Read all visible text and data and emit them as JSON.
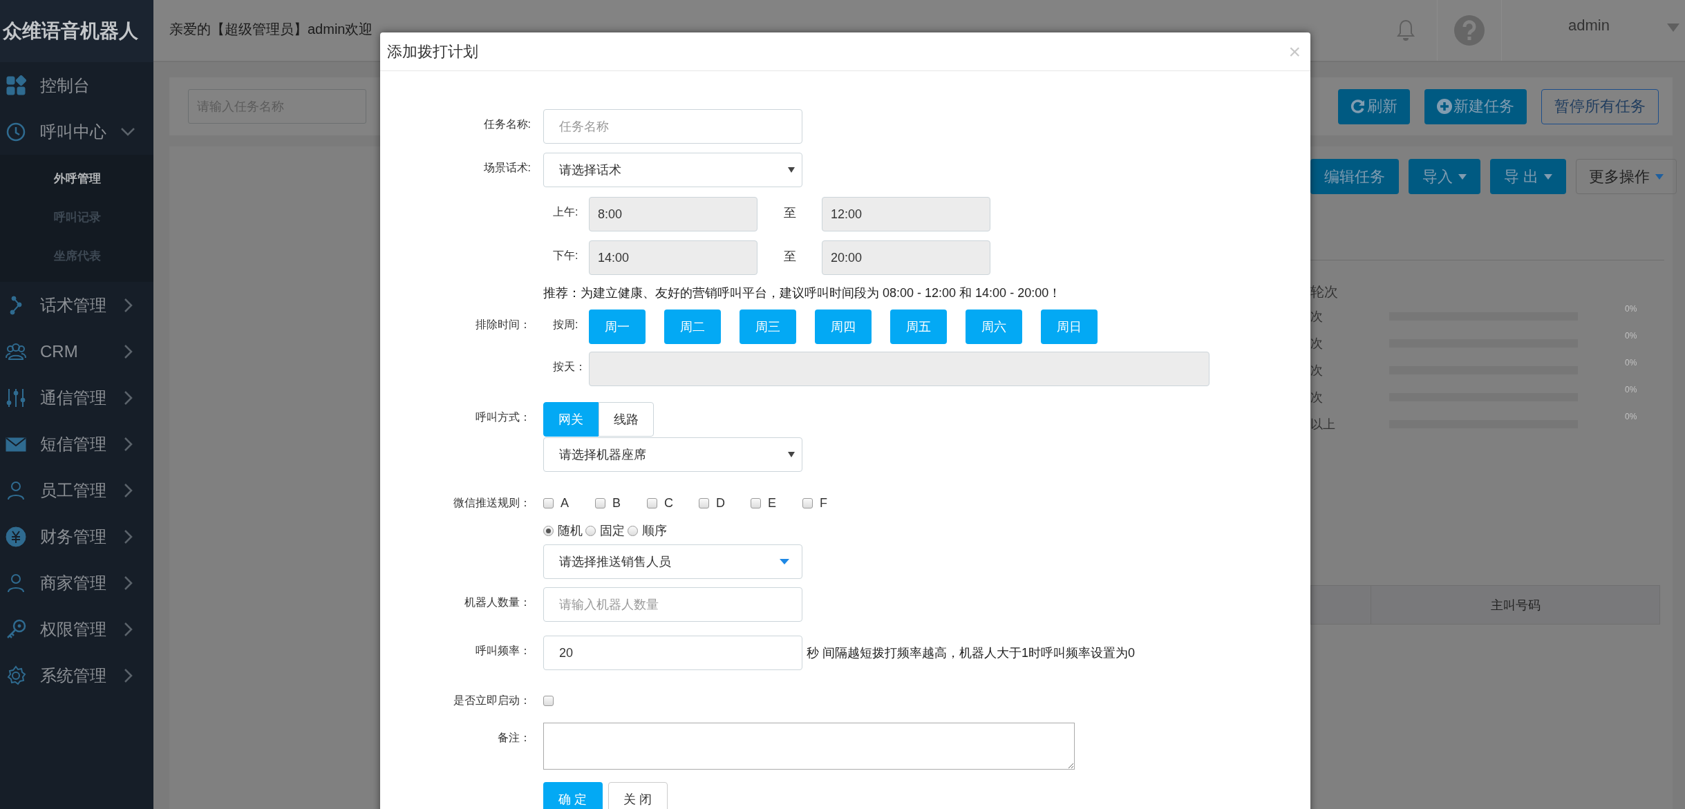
{
  "sidebar": {
    "brand": "众维语音机器人",
    "items": [
      {
        "label": "控制台",
        "kind": "link"
      },
      {
        "label": "呼叫中心",
        "kind": "group",
        "expanded": true,
        "children": [
          {
            "label": "外呼管理",
            "selected": true
          },
          {
            "label": "呼叫记录",
            "selected": false
          },
          {
            "label": "坐席代表",
            "selected": false
          }
        ]
      },
      {
        "label": "话术管理",
        "kind": "group",
        "expanded": false
      },
      {
        "label": "CRM",
        "kind": "group",
        "expanded": false
      },
      {
        "label": "通信管理",
        "kind": "group",
        "expanded": false
      },
      {
        "label": "短信管理",
        "kind": "group",
        "expanded": false
      },
      {
        "label": "员工管理",
        "kind": "group",
        "expanded": false
      },
      {
        "label": "财务管理",
        "kind": "group",
        "expanded": false
      },
      {
        "label": "商家管理",
        "kind": "group",
        "expanded": false
      },
      {
        "label": "权限管理",
        "kind": "group",
        "expanded": false
      },
      {
        "label": "系统管理",
        "kind": "group",
        "expanded": false
      }
    ]
  },
  "header": {
    "greeting": "亲爱的【超级管理员】admin欢迎",
    "user": "admin"
  },
  "toolbar": {
    "search_placeholder": "请输入任务名称",
    "buttons": [
      {
        "label": "刷新",
        "kind": "primary"
      },
      {
        "label": "新建任务",
        "kind": "primary"
      },
      {
        "label": "暂停所有任务",
        "kind": "outline"
      }
    ]
  },
  "actions": [
    {
      "label": "编辑任务",
      "kind": "primary",
      "dropdown": false
    },
    {
      "label": "导入",
      "kind": "primary",
      "dropdown": true
    },
    {
      "label": "导 出",
      "kind": "primary",
      "dropdown": true
    },
    {
      "label": "更多操作",
      "kind": "default",
      "dropdown": true
    }
  ],
  "stats": {
    "title": "轮次",
    "rows": [
      {
        "label": "次",
        "level": 0,
        "reading": "0%"
      },
      {
        "label": "次",
        "level": 0,
        "reading": "0%"
      },
      {
        "label": "次",
        "level": 0,
        "reading": "0%"
      },
      {
        "label": "次",
        "level": 0,
        "reading": "0%"
      },
      {
        "label": "以上",
        "level": 0,
        "reading": "0%"
      }
    ]
  },
  "table": {
    "columns": [
      "主叫号码"
    ]
  },
  "modal": {
    "title": "添加拨打计划",
    "close": "×",
    "task_name": {
      "label": "任务名称:",
      "placeholder": "任务名称"
    },
    "script": {
      "label": "场景话术:",
      "value": "请选择话术"
    },
    "hours": [
      {
        "label": "上午:",
        "from": "8:00",
        "separator": "至",
        "to": "12:00"
      },
      {
        "label": "下午:",
        "from": "14:00",
        "separator": "至",
        "to": "20:00"
      }
    ],
    "recommendation": "推荐：为建立健康、友好的营销呼叫平台，建议呼叫时间段为 08:00 - 12:00 和 14:00 - 20:00！",
    "exclude": {
      "label": "排除时间：",
      "week_label": "按周:",
      "days": [
        "周一",
        "周二",
        "周三",
        "周四",
        "周五",
        "周六",
        "周日"
      ],
      "day_label": "按天："
    },
    "call_mode": {
      "label": "呼叫方式：",
      "options": [
        {
          "label": "网关",
          "selected": true
        },
        {
          "label": "线路",
          "selected": false
        }
      ],
      "seat_select": "请选择机器座席"
    },
    "wechat": {
      "label": "微信推送规则：",
      "grades": [
        {
          "label": "A",
          "checked": false
        },
        {
          "label": "B",
          "checked": false
        },
        {
          "label": "C",
          "checked": false
        },
        {
          "label": "D",
          "checked": false
        },
        {
          "label": "E",
          "checked": false
        },
        {
          "label": "F",
          "checked": false
        }
      ],
      "modes": [
        {
          "label": "随机",
          "selected": true
        },
        {
          "label": "固定",
          "selected": false
        },
        {
          "label": "顺序",
          "selected": false
        }
      ],
      "sales_select": "请选择推送销售人员"
    },
    "robots": {
      "label": "机器人数量：",
      "placeholder": "请输入机器人数量"
    },
    "frequency": {
      "label": "呼叫频率：",
      "value": "20",
      "hint": "秒 间隔越短拨打频率越高，机器人大于1时呼叫频率设置为0"
    },
    "start_now": {
      "label": "是否立即启动：",
      "checked": false
    },
    "note": {
      "label": "备注："
    },
    "buttons": [
      {
        "label": "确 定",
        "kind": "primary"
      },
      {
        "label": "关 闭",
        "kind": "default"
      }
    ]
  }
}
